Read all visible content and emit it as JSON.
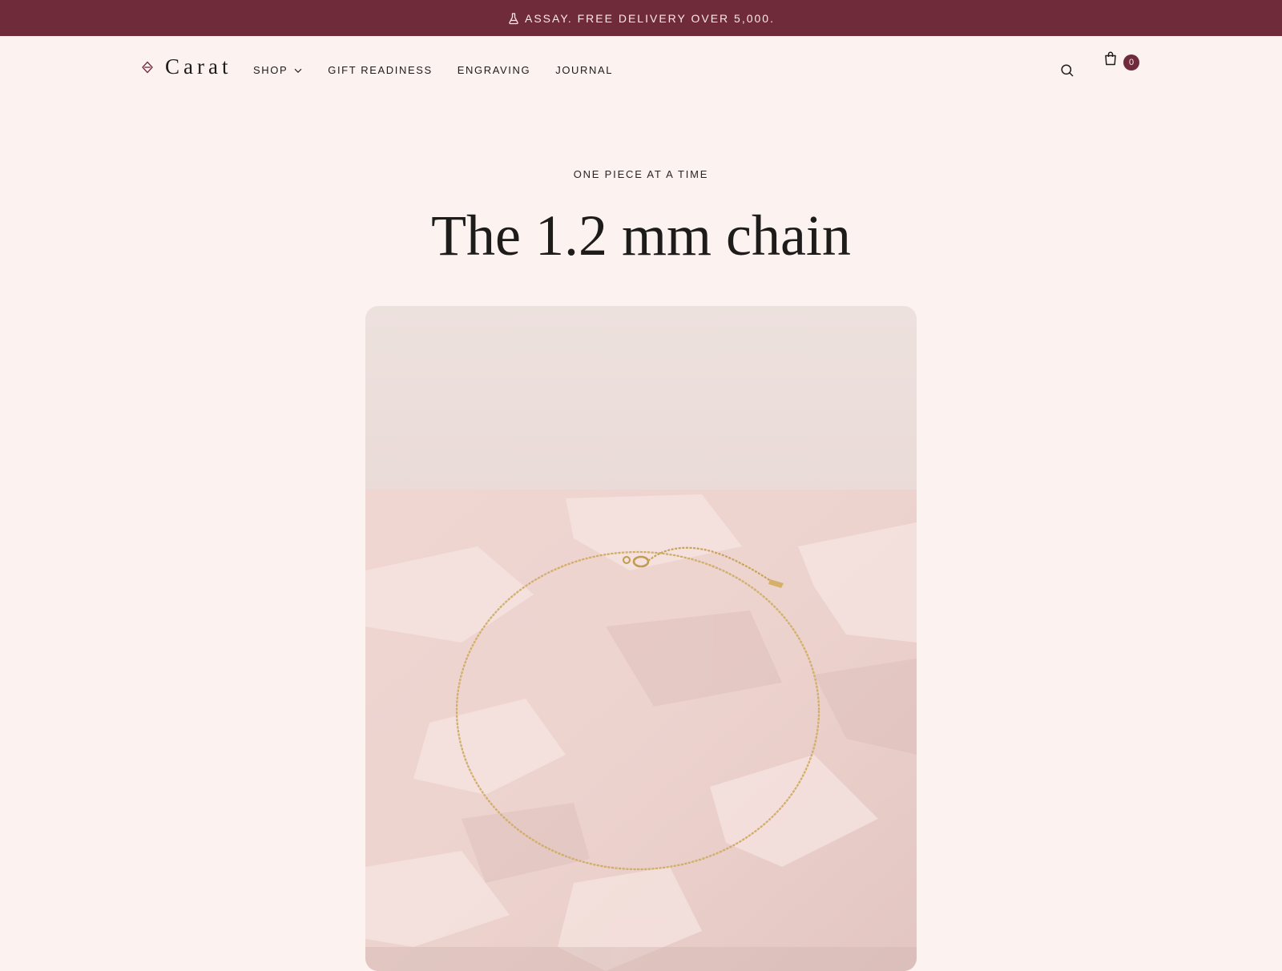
{
  "announcement": {
    "icon": "flask-icon",
    "text": "ASSAY. FREE DELIVERY OVER 5,000."
  },
  "header": {
    "logo_icon": "diamond-icon",
    "logo_text": "Carat",
    "nav": [
      {
        "label": "SHOP",
        "has_dropdown": true
      },
      {
        "label": "GIFT READINESS"
      },
      {
        "label": "ENGRAVING"
      },
      {
        "label": "JOURNAL"
      }
    ],
    "search_icon": "search-icon",
    "cart_icon": "shopping-bag-icon",
    "cart_count": "0"
  },
  "hero": {
    "eyebrow": "ONE PIECE AT A TIME",
    "title": "The 1.2 mm chain",
    "image_subject": "gold-chain-necklace"
  },
  "colors": {
    "announcement_bg": "#6f2b3a",
    "page_bg": "#fcf3f1",
    "badge_bg": "#6f2b3a",
    "text": "#1e1b1b",
    "chain_gold": "#c9a35c"
  }
}
